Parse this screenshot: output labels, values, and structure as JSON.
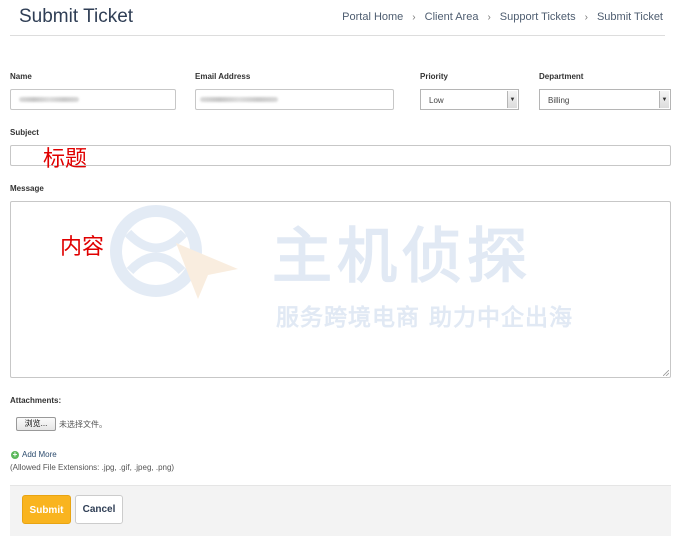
{
  "header": {
    "title": "Submit Ticket",
    "breadcrumb": [
      "Portal Home",
      "Client Area",
      "Support Tickets",
      "Submit Ticket"
    ]
  },
  "form": {
    "name_label": "Name",
    "email_label": "Email Address",
    "priority_label": "Priority",
    "priority_value": "Low",
    "department_label": "Department",
    "department_value": "Billing",
    "subject_label": "Subject",
    "subject_overlay": "标题",
    "message_label": "Message",
    "message_overlay": "内容",
    "attachments_label": "Attachments:",
    "browse_button": "浏览...",
    "no_file_text": "未选择文件。",
    "add_more": "Add More",
    "allowed_extensions": "(Allowed File Extensions: .jpg, .gif, .jpeg, .png)"
  },
  "watermark": {
    "main": "主机侦探",
    "sub": "服务跨境电商 助力中企出海"
  },
  "buttons": {
    "submit": "Submit",
    "cancel": "Cancel"
  },
  "colors": {
    "accent": "#f9b41f",
    "title": "#2f3e55",
    "overlay_red": "#e00000",
    "watermark": "#c9d8ec"
  }
}
